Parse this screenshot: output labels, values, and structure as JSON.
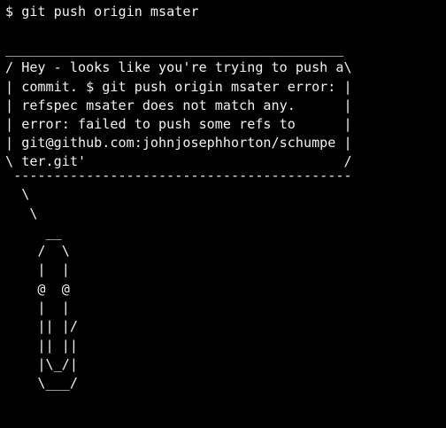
{
  "terminal": {
    "prompt_line": "$ git push origin msater",
    "speech_bubble": {
      "top_border": "__________________________________________",
      "lines": [
        "/ Hey - looks like you're trying to push a\\",
        "| commit. $ git push origin msater error: |",
        "| refspec msater does not match any.      |",
        "| error: failed to push some refs to      |",
        "| git@github.com:johnjosephhorton/schumpe |",
        "\\ ter.git'                                /"
      ]
    },
    "ascii_art": " ------------------------------------------\n  \\\n   \\\n     __\n    /  \\\n    |  |\n    @  @\n    |  |\n    || |/\n    || ||\n    |\\_/|\n    \\___/"
  }
}
